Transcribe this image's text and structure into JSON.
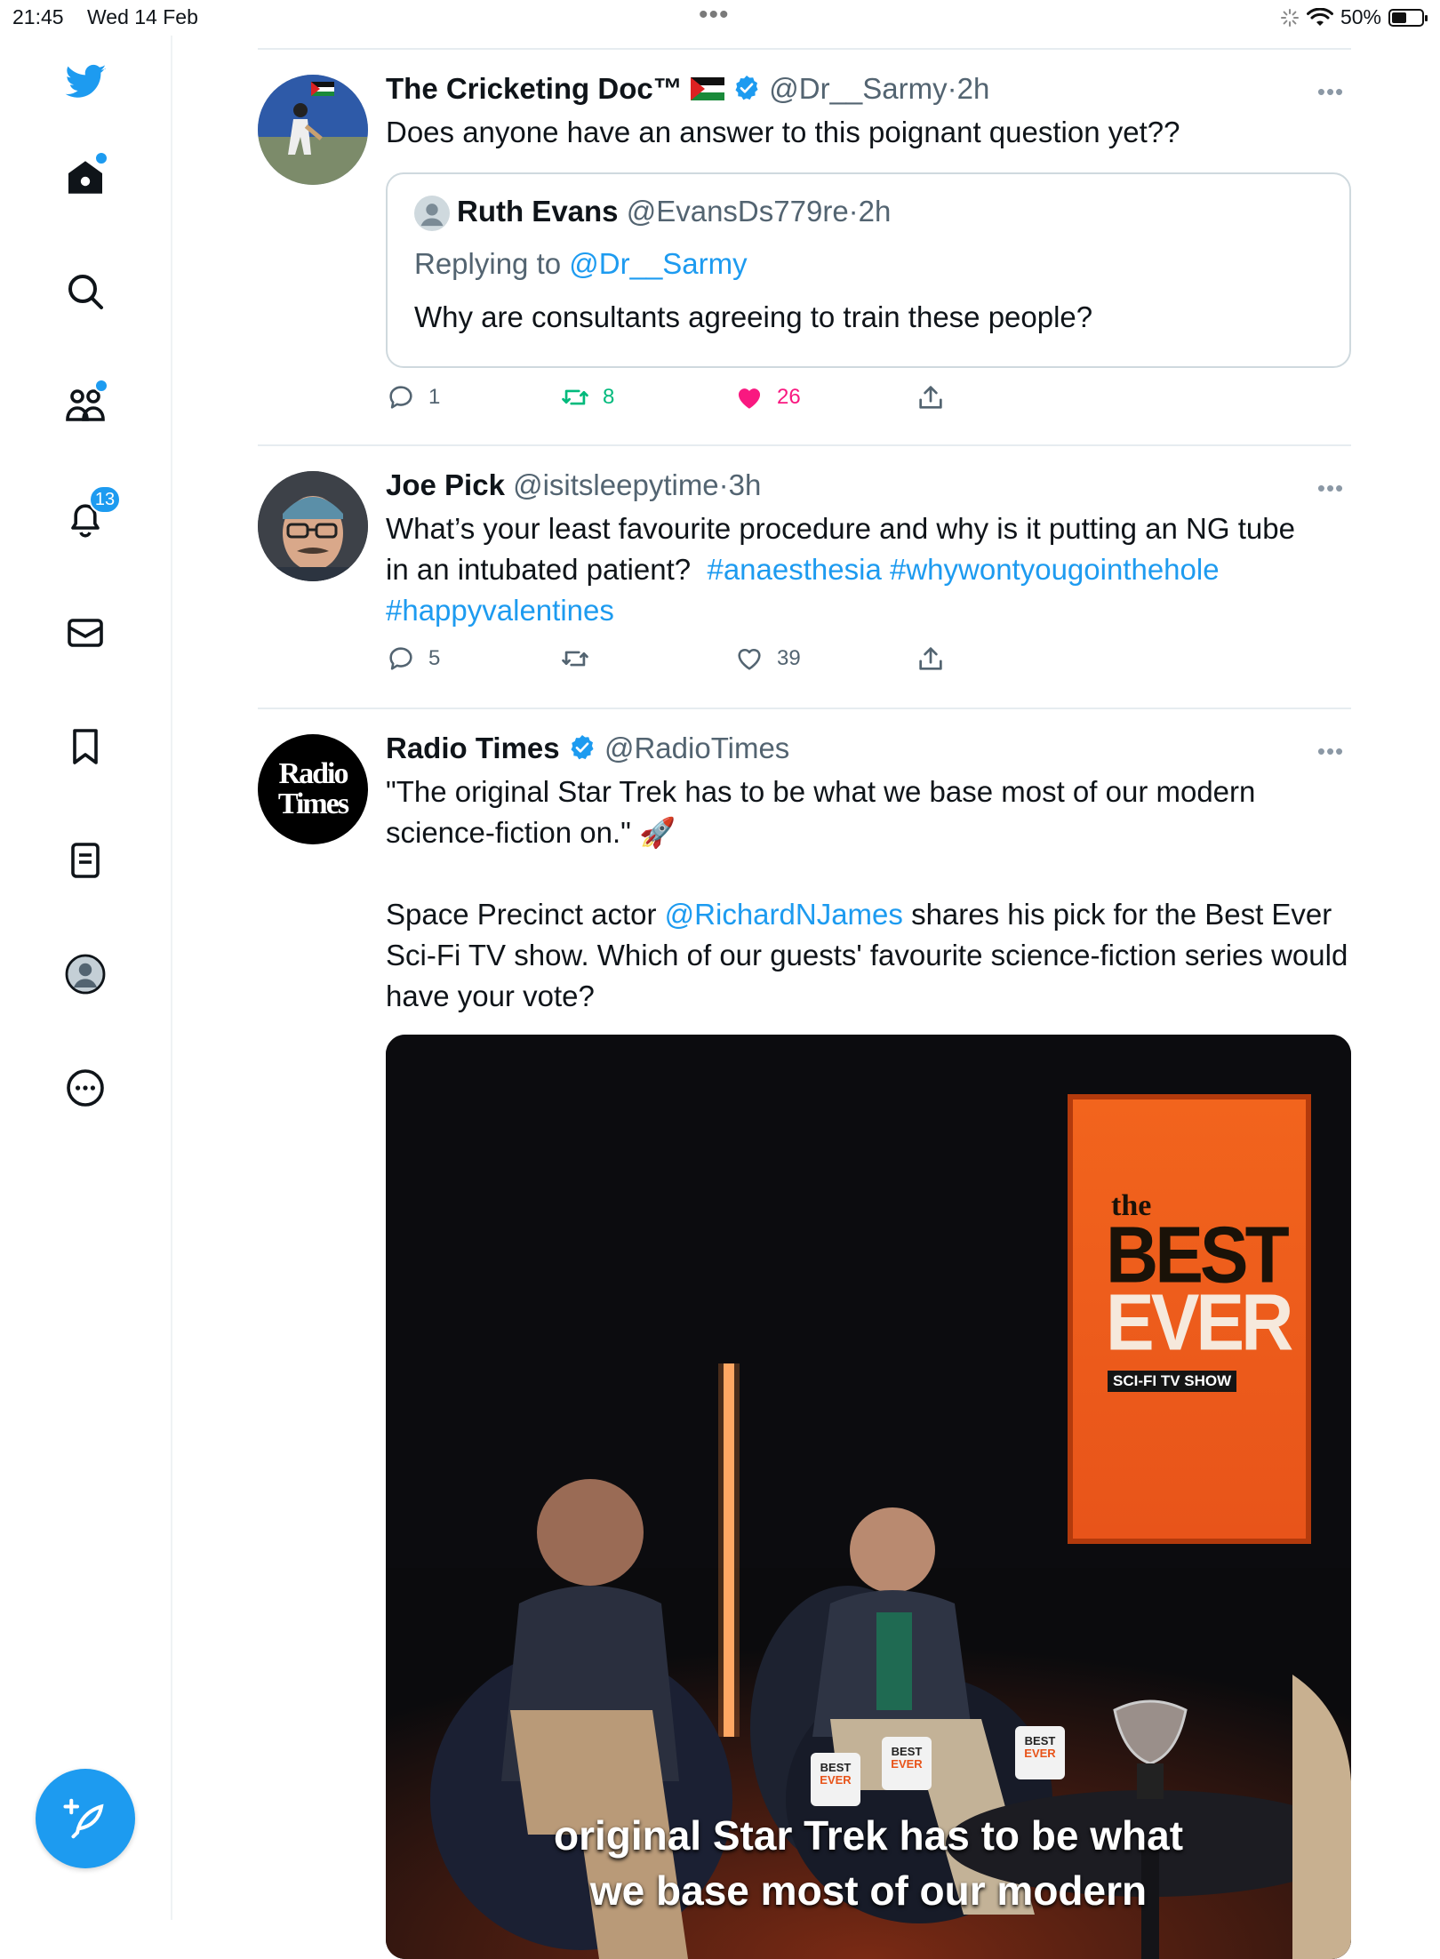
{
  "status_bar": {
    "time": "21:45",
    "date": "Wed 14 Feb",
    "battery": "50%",
    "battery_level": 0.5
  },
  "sidebar": {
    "notifications_count": "13"
  },
  "tweets": [
    {
      "name": "The Cricketing Doc™",
      "handle": "@Dr__Sarmy",
      "time": "2h",
      "text": "Does anyone have an answer to this poignant question yet??",
      "quote": {
        "name": "Ruth Evans",
        "handle": "@EvansDs779re",
        "time": "2h",
        "replying_prefix": "Replying to ",
        "replying_to": "@Dr__Sarmy",
        "text": "Why are consultants agreeing to train these people?"
      },
      "replies": "1",
      "retweets": "8",
      "likes": "26"
    },
    {
      "name": "Joe Pick",
      "handle": "@isitsleepytime",
      "time": "3h",
      "text_line1": "What’s your least favourite procedure and why is it putting an NG tube",
      "text_line2": "in an intubated patient?",
      "hashtag1": "#anaesthesia",
      "hashtag2": "#whywontyougointhehole",
      "hashtag3": "#happyvalentines",
      "replies": "5",
      "likes": "39"
    },
    {
      "name": "Radio Times",
      "handle": "@RadioTimes",
      "avatar_word1": "Radio",
      "avatar_word2": "Times",
      "text1": "\"The original Star Trek has to be what we base most of our modern science-fiction on.\" 🚀",
      "text2_before": "Space Precinct actor ",
      "mention": "@RichardNJames",
      "text2_after": " shares his pick for the Best Ever Sci-Fi TV show. Which of our guests' favourite science-fiction series would have your vote?",
      "video": {
        "sign_the": "the",
        "sign_best": "BEST",
        "sign_ever": "EVER",
        "sign_sub": "SCI-FI TV SHOW",
        "mug_best": "BEST",
        "mug_ever": "EVER",
        "caption_line1": "original Star Trek has to be what",
        "caption_line2": "we base most of our modern"
      }
    }
  ],
  "colors": {
    "accent": "#1d9bf0",
    "retweet_green": "#00ba7c",
    "like_pink": "#f91880",
    "secondary_text": "#536471",
    "divider": "#e6ecf0"
  }
}
